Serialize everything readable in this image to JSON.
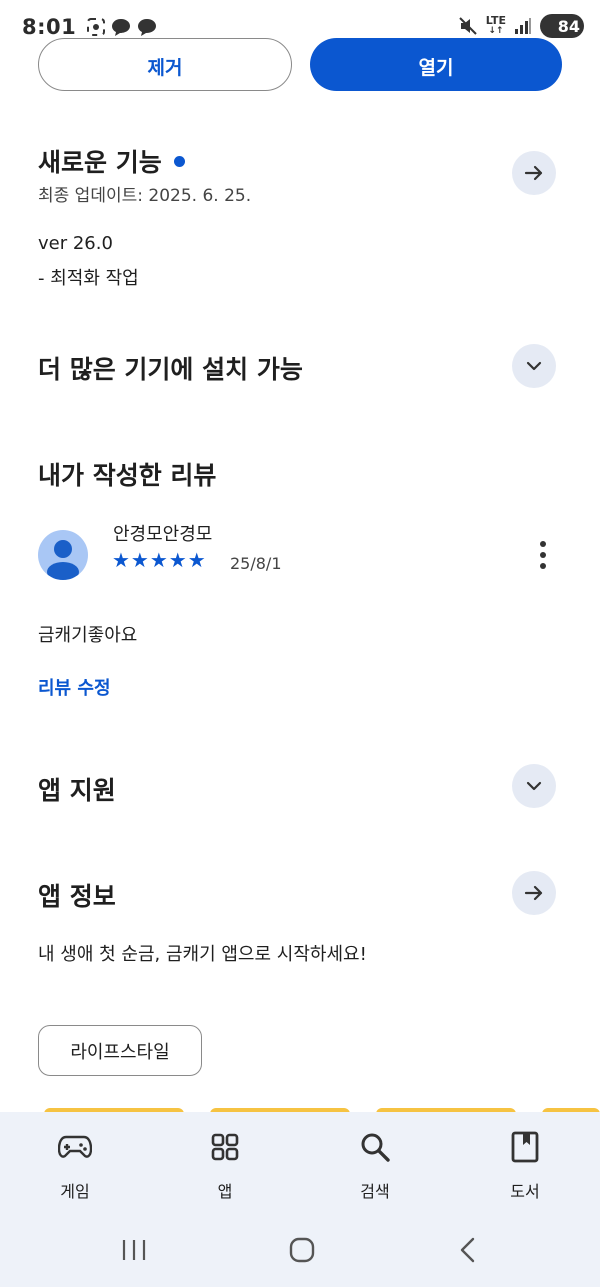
{
  "status_bar": {
    "time": "8:01",
    "network": "LTE",
    "battery": "84"
  },
  "actions": {
    "uninstall_label": "제거",
    "open_label": "열기"
  },
  "whats_new": {
    "title": "새로운 기능",
    "last_updated": "최종 업데이트: 2025. 6. 25.",
    "version": "ver 26.0",
    "note": "- 최적화 작업"
  },
  "more_devices": {
    "title": "더 많은 기기에 설치 가능"
  },
  "my_review": {
    "title": "내가 작성한 리뷰",
    "reviewer": "안경모안경모",
    "rating": 5,
    "stars": "★★★★★",
    "date": "25/8/1",
    "text": "금캐기좋아요",
    "edit_label": "리뷰 수정"
  },
  "app_support": {
    "title": "앱 지원"
  },
  "app_info": {
    "title": "앱 정보",
    "description": "내 생애 첫 순금, 금캐기 앱으로 시작하세요!",
    "category": "라이프스타일"
  },
  "bottom_nav": {
    "items": [
      {
        "label": "게임",
        "icon": "gamepad-icon"
      },
      {
        "label": "앱",
        "icon": "apps-grid-icon"
      },
      {
        "label": "검색",
        "icon": "search-icon"
      },
      {
        "label": "도서",
        "icon": "book-icon"
      }
    ]
  },
  "colors": {
    "accent": "#0b57d0",
    "chip_bg": "#e5eaf4",
    "nav_bg": "#eef2f9"
  }
}
